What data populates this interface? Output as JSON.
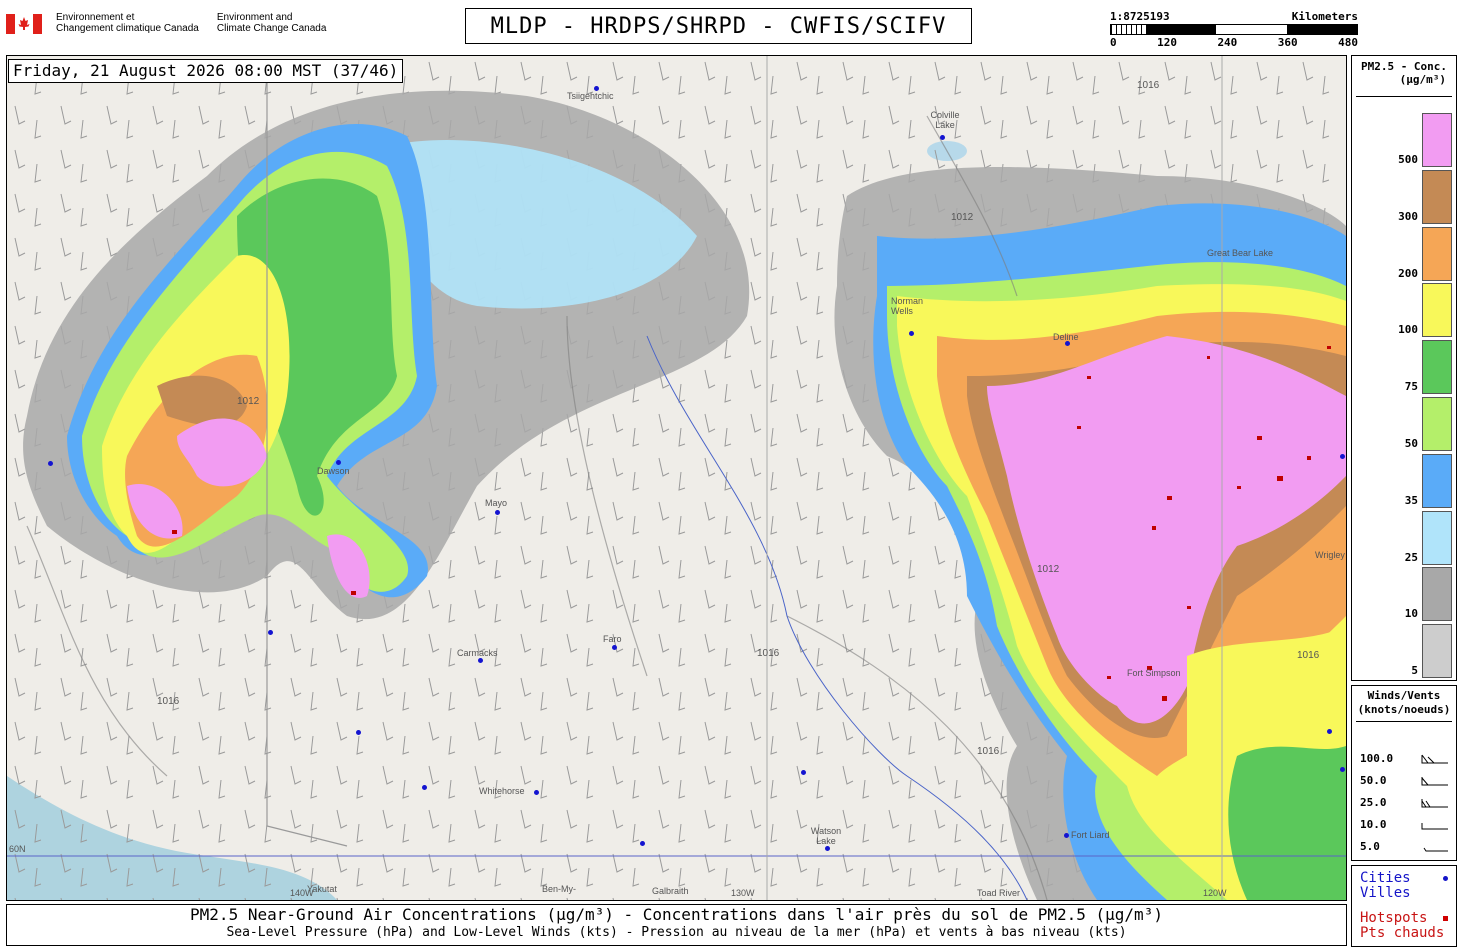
{
  "header": {
    "gov_fr": [
      "Environnement et",
      "Changement climatique Canada"
    ],
    "gov_en": [
      "Environment and",
      "Climate Change Canada"
    ],
    "title": "MLDP - HRDPS/SHRPD - CWFIS/SCIFV",
    "scale": {
      "ratio": "1:8725193",
      "unit": "Kilometers",
      "ticks": [
        "0",
        "120",
        "240",
        "360",
        "480"
      ]
    }
  },
  "map": {
    "datetime": "Friday, 21 August 2026 08:00 MST (37/46)",
    "cities": [
      "Tsiigehtchic",
      "Colville Lake",
      "Norman Wells",
      "Deline",
      "Mayo",
      "Dawson",
      "Carmacks",
      "Faro",
      "Whitehorse",
      "Watson Lake",
      "Fort Liard",
      "Yakutat",
      "Ben-My-",
      "Galbraith",
      "Toad River",
      "Fort Simpson",
      "Great Bear Lake",
      "Wrigley"
    ],
    "isobar_labels": [
      "1012",
      "1016"
    ],
    "grid_labels": [
      "60N",
      "140W",
      "130W",
      "120W"
    ]
  },
  "legend": {
    "title": [
      "PM2.5 - Conc.",
      "(µg/m³)"
    ],
    "levels": [
      {
        "value": "500",
        "color": "#f29cf2"
      },
      {
        "value": "300",
        "color": "#c48a55"
      },
      {
        "value": "200",
        "color": "#f5a656"
      },
      {
        "value": "100",
        "color": "#f8f85a"
      },
      {
        "value": "75",
        "color": "#5bc85b"
      },
      {
        "value": "50",
        "color": "#b4ef6a"
      },
      {
        "value": "35",
        "color": "#5aabf8"
      },
      {
        "value": "25",
        "color": "#b0e4fa"
      },
      {
        "value": "10",
        "color": "#a8a8a8"
      },
      {
        "value": "5",
        "color": "#cdcdcd"
      }
    ]
  },
  "winds": {
    "title": [
      "Winds/Vents",
      "(knots/noeuds)"
    ],
    "speeds": [
      "100.0",
      "50.0",
      "25.0",
      "10.0",
      "5.0"
    ]
  },
  "markers": {
    "cities": [
      "Cities",
      "Villes"
    ],
    "hotspots": [
      "Hotspots",
      "Pts chauds"
    ]
  },
  "caption": {
    "line1": "PM2.5 Near-Ground Air Concentrations (µg/m³) - Concentrations dans l'air près du sol de PM2.5 (µg/m³)",
    "line2": "Sea-Level Pressure (hPa) and Low-Level Winds (kts) - Pression au niveau de la mer (hPa) et vents à bas niveau (kts)"
  }
}
